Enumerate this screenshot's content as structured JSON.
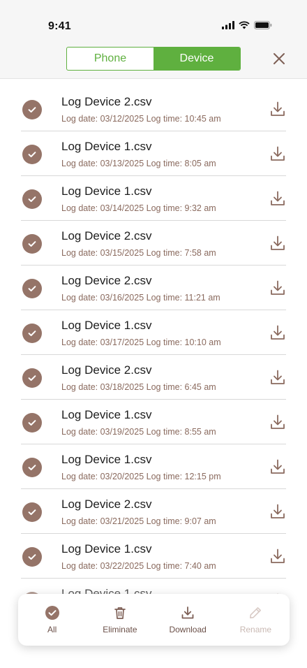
{
  "status_bar": {
    "time": "9:41"
  },
  "segmented": {
    "phone_label": "Phone",
    "device_label": "Device",
    "selected": "Device"
  },
  "colors": {
    "accent_green": "#5fb03f",
    "brown": "#957468",
    "meta_text": "#8a6a5e"
  },
  "files": [
    {
      "name": "Log Device 2.csv",
      "meta": "Log date: 03/12/2025 Log time: 10:45 am"
    },
    {
      "name": "Log Device 1.csv",
      "meta": "Log date: 03/13/2025 Log time: 8:05 am"
    },
    {
      "name": "Log Device 1.csv",
      "meta": "Log date: 03/14/2025 Log time: 9:32 am"
    },
    {
      "name": "Log Device 2.csv",
      "meta": "Log date: 03/15/2025 Log time: 7:58 am"
    },
    {
      "name": "Log Device 2.csv",
      "meta": "Log date: 03/16/2025 Log time: 11:21 am"
    },
    {
      "name": "Log Device 1.csv",
      "meta": "Log date: 03/17/2025 Log time: 10:10 am"
    },
    {
      "name": "Log Device 2.csv",
      "meta": "Log date: 03/18/2025 Log time: 6:45 am"
    },
    {
      "name": "Log Device 1.csv",
      "meta": "Log date: 03/19/2025 Log time: 8:55 am"
    },
    {
      "name": "Log Device 1.csv",
      "meta": "Log date: 03/20/2025 Log time: 12:15 pm"
    },
    {
      "name": "Log Device 2.csv",
      "meta": "Log date: 03/21/2025 Log time: 9:07 am"
    },
    {
      "name": "Log Device 1.csv",
      "meta": "Log date: 03/22/2025 Log time: 7:40 am"
    },
    {
      "name": "Log Device 1.csv",
      "meta": ""
    }
  ],
  "toolbar": {
    "all_label": "All",
    "eliminate_label": "Eliminate",
    "download_label": "Download",
    "rename_label": "Rename"
  }
}
